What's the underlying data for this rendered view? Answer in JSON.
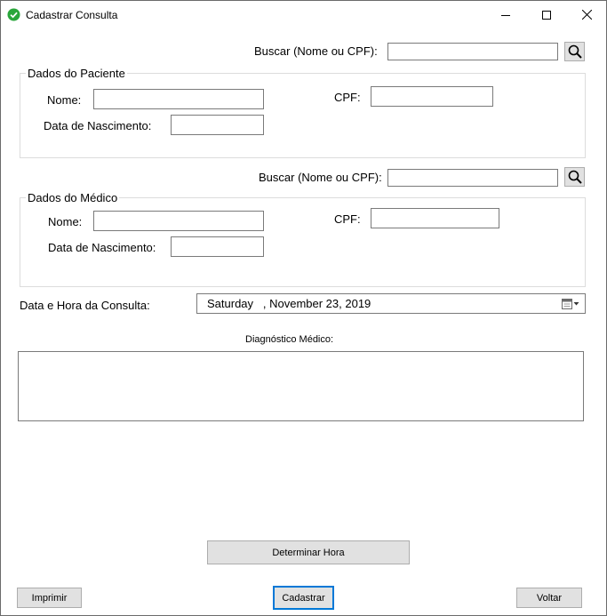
{
  "window": {
    "title": "Cadastrar Consulta",
    "icon": "check-circle-icon",
    "controls": [
      "minimize-icon",
      "maximize-icon",
      "close-icon"
    ]
  },
  "paciente_search": {
    "label": "Buscar (Nome ou CPF):",
    "value": ""
  },
  "paciente": {
    "group_title": "Dados do Paciente",
    "nome_label": "Nome:",
    "nome_value": "",
    "cpf_label": "CPF:",
    "cpf_value": "",
    "nascimento_label": "Data de Nascimento:",
    "nascimento_value": ""
  },
  "medico_search": {
    "label": "Buscar (Nome ou CPF):",
    "value": ""
  },
  "medico": {
    "group_title": "Dados do Médico",
    "nome_label": "Nome:",
    "nome_value": "",
    "cpf_label": "CPF:",
    "cpf_value": "",
    "nascimento_label": "Data de Nascimento:",
    "nascimento_value": ""
  },
  "consulta": {
    "datetime_label": "Data e Hora da Consulta:",
    "datetime_value": "Saturday   , November 23, 2019",
    "diagnostico_label": "Diagnóstico Médico:",
    "diagnostico_value": ""
  },
  "buttons": {
    "determinar_hora": "Determinar Hora",
    "imprimir": "Imprimir",
    "cadastrar": "Cadastrar",
    "voltar": "Voltar"
  },
  "colors": {
    "accent": "#0078d7",
    "check": "#2aa63b"
  }
}
